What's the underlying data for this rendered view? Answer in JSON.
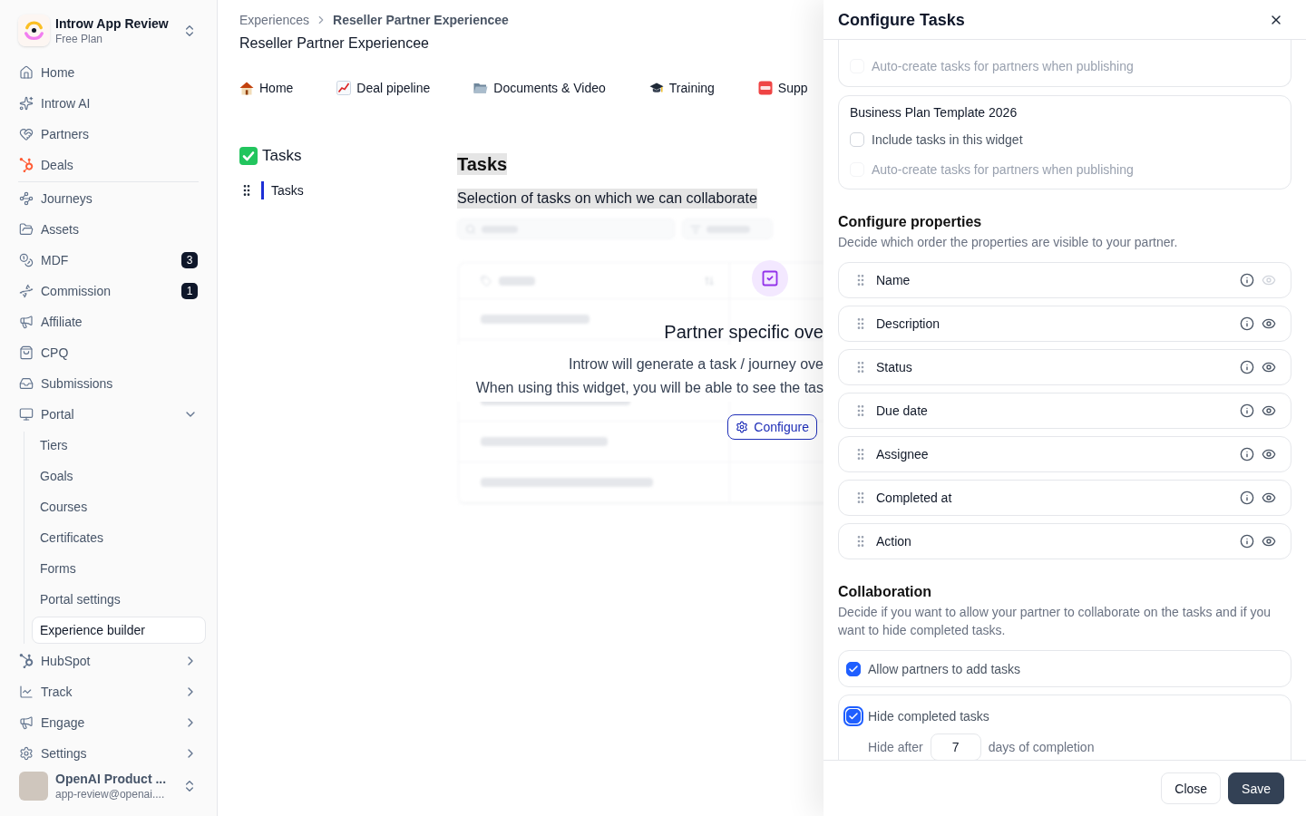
{
  "sidebar": {
    "workspace": {
      "name": "Introw App Review",
      "plan": "Free Plan"
    },
    "sections": [
      {
        "items": [
          {
            "label": "Home",
            "selected": false
          },
          {
            "label": "Introw AI",
            "selected": false
          },
          {
            "label": "Partners",
            "selected": false
          },
          {
            "label": "Deals",
            "selected": false
          }
        ]
      },
      {
        "items": [
          {
            "label": "Journeys",
            "selected": false
          },
          {
            "label": "Assets",
            "selected": false
          },
          {
            "label": "MDF",
            "selected": false,
            "badge": "3"
          },
          {
            "label": "Commission",
            "selected": false,
            "badge": "1"
          },
          {
            "label": "Affiliate",
            "selected": false
          },
          {
            "label": "CPQ",
            "selected": false
          },
          {
            "label": "Submissions",
            "selected": false
          },
          {
            "label": "Portal",
            "selected": false,
            "expanded": true,
            "children": [
              {
                "label": "Tiers",
                "selected": false
              },
              {
                "label": "Goals",
                "selected": false
              },
              {
                "label": "Courses",
                "selected": false
              },
              {
                "label": "Certificates",
                "selected": false
              },
              {
                "label": "Forms",
                "selected": false
              },
              {
                "label": "Portal settings",
                "selected": false
              },
              {
                "label": "Experience builder",
                "selected": true
              }
            ]
          },
          {
            "label": "HubSpot",
            "selected": false,
            "expanded": false
          },
          {
            "label": "Track",
            "selected": false,
            "expanded": false
          },
          {
            "label": "Engage",
            "selected": false,
            "expanded": false
          },
          {
            "label": "Settings",
            "selected": false,
            "expanded": false
          }
        ]
      }
    ],
    "user": {
      "name": "OpenAI Product ...",
      "email": "app-review@openai...."
    }
  },
  "main": {
    "breadcrumb": [
      "Experiences",
      "Reseller Partner Experiencee"
    ],
    "page_title": "Reseller Partner Experiencee",
    "tabs": [
      {
        "label": "Home",
        "selected": false
      },
      {
        "label": "Deal pipeline",
        "selected": false
      },
      {
        "label": "Documents & Video",
        "selected": false
      },
      {
        "label": "Training",
        "selected": false
      },
      {
        "label": "Supp",
        "selected": false
      }
    ],
    "experience_nav": {
      "title": "Tasks",
      "items": [
        {
          "label": "Tasks",
          "selected": true
        }
      ]
    },
    "widget": {
      "title": "Tasks",
      "description": "Selection of tasks on which we can collaborate",
      "overlay": {
        "title": "Partner specific ove",
        "lines": [
          "Introw will generate a task / journey ove",
          "When using this widget, you will be able to see the tas"
        ],
        "button": "Configure"
      }
    }
  },
  "panel": {
    "title": "Configure Tasks",
    "templates": [
      {
        "options": [
          {
            "label": "Auto-create tasks for partners when publishing",
            "checked": false,
            "disabled": true
          }
        ]
      },
      {
        "title": "Business Plan Template 2026",
        "options": [
          {
            "label": "Include tasks in this widget",
            "checked": false,
            "disabled": false
          },
          {
            "label": "Auto-create tasks for partners when publishing",
            "checked": false,
            "disabled": true
          }
        ]
      }
    ],
    "properties": {
      "title": "Configure properties",
      "description": "Decide which order the properties are visible to your partner.",
      "items": [
        {
          "label": "Name",
          "toggle_disabled": true
        },
        {
          "label": "Description",
          "toggle_disabled": false
        },
        {
          "label": "Status",
          "toggle_disabled": false
        },
        {
          "label": "Due date",
          "toggle_disabled": false
        },
        {
          "label": "Assignee",
          "toggle_disabled": false
        },
        {
          "label": "Completed at",
          "toggle_disabled": false
        },
        {
          "label": "Action",
          "toggle_disabled": false
        }
      ]
    },
    "collaboration": {
      "title": "Collaboration",
      "description": "Decide if you want to allow your partner to collaborate on the tasks and if you want to hide completed tasks.",
      "options": [
        {
          "label": "Allow partners to add tasks",
          "checked": true,
          "focused": false
        },
        {
          "label": "Hide completed tasks",
          "checked": true,
          "focused": true,
          "hide_after": {
            "prefix": "Hide after",
            "value": "7",
            "suffix": "days of completion"
          }
        }
      ]
    },
    "buttons": [
      {
        "label": "Close",
        "kind": "secondary"
      },
      {
        "label": "Save",
        "kind": "primary"
      }
    ]
  }
}
